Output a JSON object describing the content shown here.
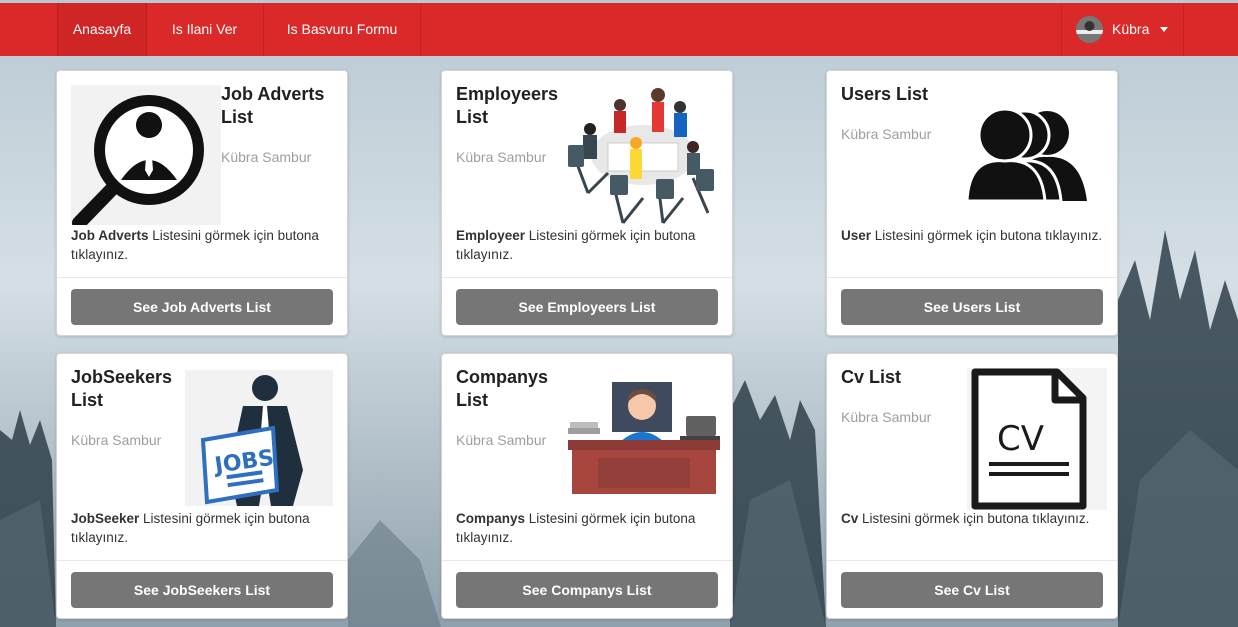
{
  "navbar": {
    "items": [
      "Anasayfa",
      "Is Ilani Ver",
      "Is Basvuru Formu"
    ],
    "user": "Kübra"
  },
  "cards": [
    {
      "title": "Job Adverts List",
      "meta": "Kübra Sambur",
      "desc_bold": "Job Adverts",
      "desc_rest": " Listesini görmek için butona tıklayınız.",
      "button": "See Job Adverts List",
      "icon": "job-search-icon"
    },
    {
      "title": "Employeers List",
      "meta": "Kübra Sambur",
      "desc_bold": "Employeer",
      "desc_rest": " Listesini görmek için butona tıklayınız.",
      "button": "See Employeers List",
      "icon": "team-meeting-icon"
    },
    {
      "title": "Users List",
      "meta": "Kübra Sambur",
      "desc_bold": "User",
      "desc_rest": " Listesini görmek için butona tıklayınız.",
      "button": "See Users List",
      "icon": "users-icon"
    },
    {
      "title": "JobSeekers List",
      "meta": "Kübra Sambur",
      "desc_bold": "JobSeeker",
      "desc_rest": " Listesini görmek için butona tıklayınız.",
      "button": "See JobSeekers List",
      "icon": "jobs-newspaper-icon"
    },
    {
      "title": "Companys List",
      "meta": "Kübra Sambur",
      "desc_bold": "Companys",
      "desc_rest": " Listesini görmek için butona tıklayınız.",
      "button": "See Companys List",
      "icon": "office-desk-icon"
    },
    {
      "title": "Cv List",
      "meta": "Kübra Sambur",
      "desc_bold": "Cv",
      "desc_rest": " Listesini görmek için butona tıklayınız.",
      "button": "See Cv List",
      "icon": "cv-document-icon"
    }
  ],
  "icons": {
    "job_adverts_icon_text": "",
    "jobs_text": "JOBS",
    "cv_text": "CV"
  }
}
